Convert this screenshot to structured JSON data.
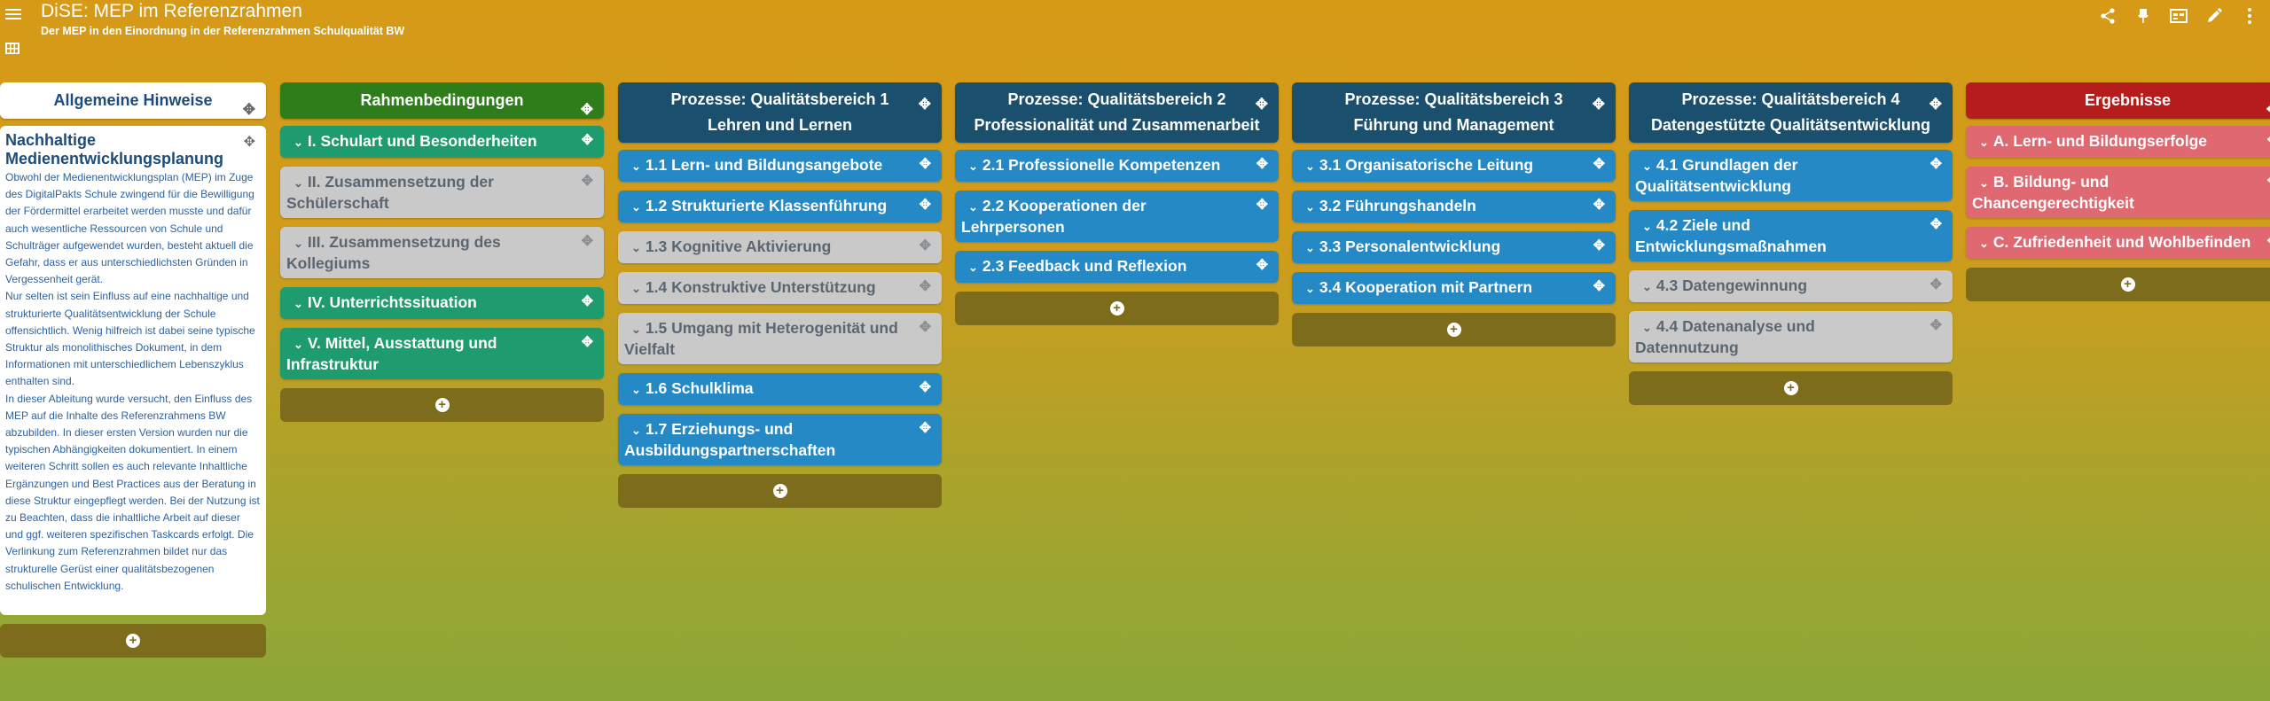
{
  "header": {
    "title": "DiSE: MEP im Referenzrahmen",
    "subtitle": "Der MEP in den Einordnung in der Referenzrahmen Schulqualität BW",
    "actions": [
      "share-icon",
      "pin-icon",
      "view-icon",
      "edit-icon",
      "more-icon"
    ]
  },
  "notes": {
    "header": "Allgemeine Hinweise",
    "card_title": "Nachhaltige Medienentwicklungsplanung",
    "p1": "Obwohl der Medienentwicklungsplan (MEP) im Zuge des DigitalPakts Schule zwingend für die Bewilligung der Fördermittel erarbeitet werden musste und dafür auch wesentliche Ressourcen von Schule und Schulträger aufgewendet wurden, besteht aktuell die Gefahr, dass er aus unterschiedlichsten Gründen in Vergessenheit gerät.",
    "p2": "Nur selten ist sein Einfluss auf eine nachhaltige und strukturierte Qualitätsentwicklung der Schule offensichtlich. Wenig hilfreich ist dabei seine typische Struktur als monolithisches Dokument, in dem Informationen mit unterschiedlichem Lebenszyklus enthalten sind.",
    "p3": "In dieser Ableitung wurde versucht, den Einfluss des MEP auf die Inhalte des Referenzrahmens BW abzubilden. In dieser ersten Version wurden nur die typischen Abhängigkeiten dokumentiert. In einem weiteren Schritt sollen es auch relevante Inhaltliche Ergänzungen und Best Practices aus der Beratung in diese Struktur eingepflegt werden. Bei der Nutzung ist zu Beachten, dass die inhaltliche Arbeit auf dieser und ggf. weiteren spezifischen Taskcards erfolgt. Die Verlinkung zum Referenzrahmen bildet nur das strukturelle Gerüst einer qualitätsbezogenen schulischen Entwicklung."
  },
  "columns": [
    {
      "title": "Rahmenbedingungen",
      "line2": "",
      "color": "#2e7d1a",
      "cards": [
        {
          "label": "I. Schulart und Besonderheiten",
          "style": "green"
        },
        {
          "label": "II. Zusammensetzung der Schülerschaft",
          "style": "grey"
        },
        {
          "label": "III. Zusammensetzung des Kollegiums",
          "style": "grey"
        },
        {
          "label": "IV. Unterrichtssituation",
          "style": "green"
        },
        {
          "label": "V. Mittel, Ausstattung und Infrastruktur",
          "style": "green"
        }
      ]
    },
    {
      "title": "Prozesse: Qualitätsbereich 1",
      "line2": "Lehren und Lernen",
      "color": "#1a4f6e",
      "cards": [
        {
          "label": "1.1 Lern- und Bildungsangebote",
          "style": "blue"
        },
        {
          "label": "1.2 Strukturierte Klassenführung",
          "style": "blue"
        },
        {
          "label": "1.3 Kognitive Aktivierung",
          "style": "grey"
        },
        {
          "label": "1.4 Konstruktive Unterstützung",
          "style": "grey"
        },
        {
          "label": "1.5 Umgang mit Heterogenität und Vielfalt",
          "style": "grey"
        },
        {
          "label": "1.6 Schulklima",
          "style": "blue"
        },
        {
          "label": "1.7 Erziehungs- und Ausbildungspartnerschaften",
          "style": "blue"
        }
      ]
    },
    {
      "title": "Prozesse: Qualitätsbereich 2",
      "line2": "Professionalität und Zusammenarbeit",
      "color": "#1a4f6e",
      "cards": [
        {
          "label": "2.1 Professionelle Kompetenzen",
          "style": "blue"
        },
        {
          "label": "2.2 Kooperationen der Lehrpersonen",
          "style": "blue"
        },
        {
          "label": "2.3 Feedback und Reflexion",
          "style": "blue"
        }
      ]
    },
    {
      "title": "Prozesse: Qualitätsbereich 3",
      "line2": "Führung und Management",
      "color": "#1a4f6e",
      "cards": [
        {
          "label": "3.1 Organisatorische Leitung",
          "style": "blue"
        },
        {
          "label": "3.2 Führungshandeln",
          "style": "blue"
        },
        {
          "label": "3.3 Personalentwicklung",
          "style": "blue"
        },
        {
          "label": "3.4 Kooperation mit Partnern",
          "style": "blue"
        }
      ]
    },
    {
      "title": "Prozesse: Qualitätsbereich 4",
      "line2": "Datengestützte Qualitätsentwicklung",
      "color": "#1a4f6e",
      "cards": [
        {
          "label": "4.1 Grundlagen der Qualitätsentwicklung",
          "style": "blue"
        },
        {
          "label": "4.2 Ziele und Entwicklungsmaßnahmen",
          "style": "blue"
        },
        {
          "label": "4.3 Datengewinnung",
          "style": "grey"
        },
        {
          "label": "4.4 Datenanalyse und Datennutzung",
          "style": "grey"
        }
      ]
    },
    {
      "title": "Ergebnisse",
      "line2": "",
      "color": "#b71c1c",
      "cards": [
        {
          "label": "A. Lern- und Bildungserfolge",
          "style": "red"
        },
        {
          "label": "B. Bildung- und Chancengerechtigkeit",
          "style": "red"
        },
        {
          "label": "C. Zufriedenheit und Wohlbefinden",
          "style": "red"
        }
      ]
    }
  ]
}
